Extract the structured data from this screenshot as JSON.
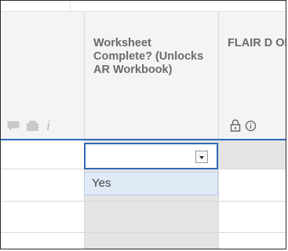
{
  "grid": {
    "columns": [
      {
        "id": "col-1",
        "title": ""
      },
      {
        "id": "col-2",
        "title": "Worksheet Complete? (Unlocks AR Workbook)"
      },
      {
        "id": "col-3",
        "title": "FLAIR D OLO"
      }
    ],
    "header_icons_col1": [
      "comment-icon",
      "folder-icon",
      "info-italic-icon"
    ],
    "header_icons_col3": [
      "lock-icon",
      "info-circle-icon"
    ]
  },
  "dropdown": {
    "current_value": "",
    "options": [
      "Yes"
    ]
  },
  "colors": {
    "accent": "#2d6bb5",
    "header_bg": "#f4f4f4",
    "locked_cell_bg": "#e4e4e4",
    "option_highlight": "#dfeaf6"
  }
}
